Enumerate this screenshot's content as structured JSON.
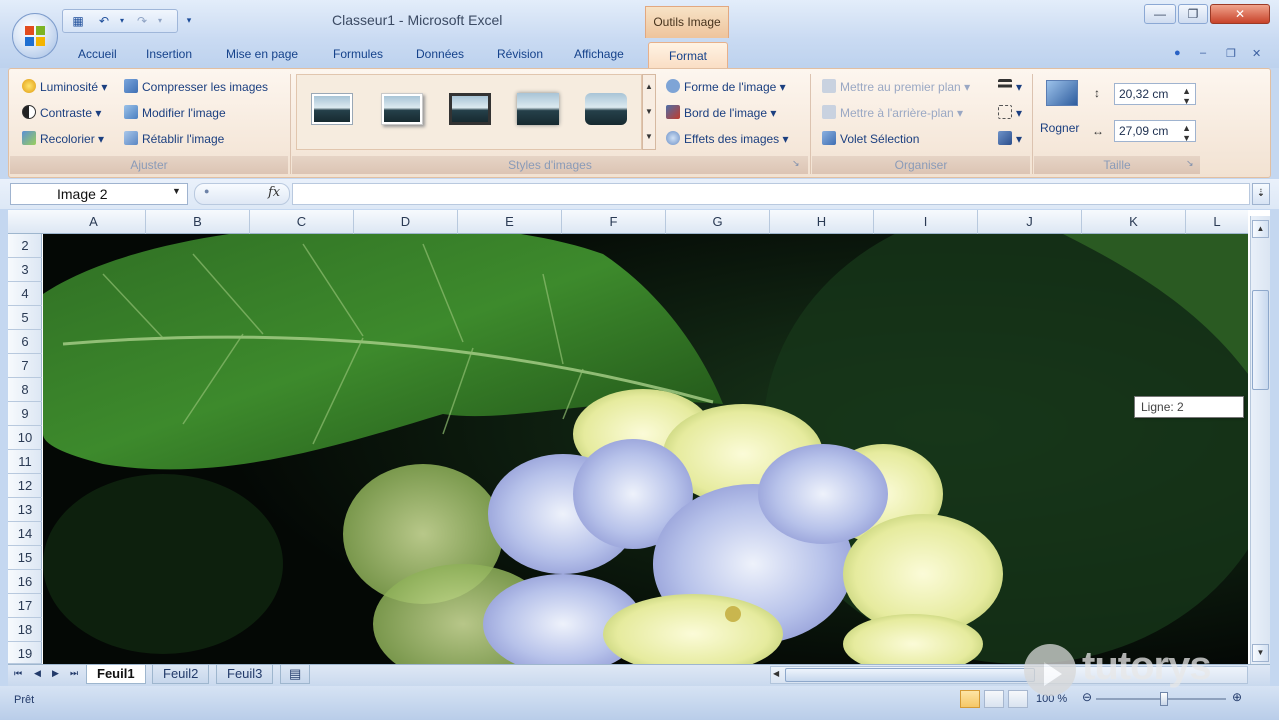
{
  "window": {
    "title": "Classeur1 - Microsoft Excel",
    "contextual_tab_group": "Outils Image"
  },
  "tabs": [
    "Accueil",
    "Insertion",
    "Mise en page",
    "Formules",
    "Données",
    "Révision",
    "Affichage",
    "Format"
  ],
  "active_tab": "Format",
  "ribbon": {
    "ajuster": {
      "label": "Ajuster",
      "luminosite": "Luminosité",
      "contraste": "Contraste",
      "recolorier": "Recolorier",
      "compresser": "Compresser les images",
      "modifier": "Modifier l'image",
      "retablir": "Rétablir l'image"
    },
    "styles": {
      "label": "Styles d'images",
      "forme": "Forme de l'image",
      "bord": "Bord de l'image",
      "effets": "Effets des images"
    },
    "organiser": {
      "label": "Organiser",
      "premier_plan": "Mettre au premier plan",
      "arriere_plan": "Mettre à l'arrière-plan",
      "volet": "Volet Sélection"
    },
    "taille": {
      "label": "Taille",
      "rogner": "Rogner",
      "hauteur": "20,32 cm",
      "largeur": "27,09 cm"
    }
  },
  "formula_bar": {
    "name_box": "Image 2",
    "fx": "fx",
    "value": ""
  },
  "columns": [
    "A",
    "B",
    "C",
    "D",
    "E",
    "F",
    "G",
    "H",
    "I",
    "J",
    "K",
    "L"
  ],
  "rows": [
    "2",
    "3",
    "4",
    "5",
    "6",
    "7",
    "8",
    "9",
    "10",
    "11",
    "12",
    "13",
    "14",
    "15",
    "16",
    "17",
    "18",
    "19"
  ],
  "tooltip": "Ligne: 2",
  "sheets": [
    "Feuil1",
    "Feuil2",
    "Feuil3"
  ],
  "active_sheet": "Feuil1",
  "status": {
    "text": "Prêt",
    "zoom": "100 %"
  },
  "watermark": "tutorys"
}
